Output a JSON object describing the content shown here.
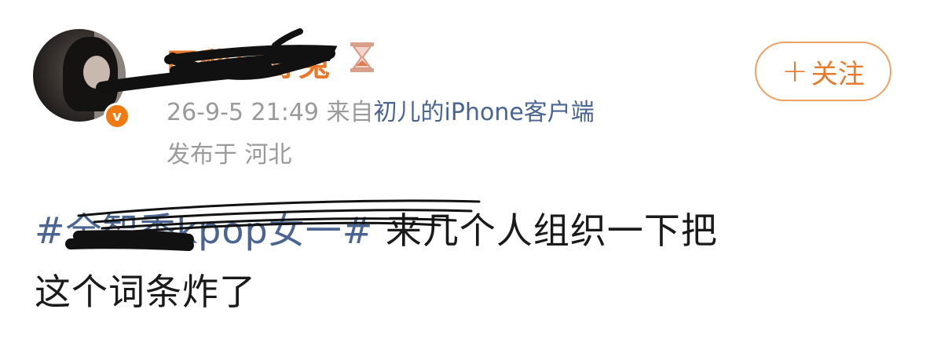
{
  "post": {
    "username": "田黎日野兔",
    "timestamp": "26-9-5 21:49",
    "source_prefix": "来自",
    "source": "初儿的iPhone客户端",
    "location": "发布于 河北",
    "topic": "#全智秀kpop女一#",
    "text_line1": "来几个人组织一下把",
    "text_line2": "这个词条炸了"
  },
  "follow_button": {
    "plus": "+",
    "label": "关注"
  },
  "icons": {
    "avatar": "user-avatar",
    "verified": "verified-badge-icon",
    "hourglass": "hourglass-icon"
  },
  "colors": {
    "accent": "#e8782a",
    "link": "#4a6592",
    "meta": "#9a9a9a",
    "text": "#1a1a1a",
    "verified": "#f07a12"
  }
}
